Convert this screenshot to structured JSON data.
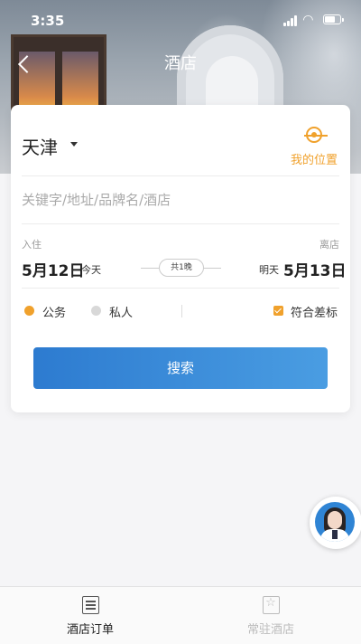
{
  "status_bar": {
    "time": "3:35"
  },
  "nav": {
    "title": "酒店"
  },
  "search_card": {
    "city": "天津",
    "my_location_label": "我的位置",
    "keyword_placeholder": "关键字/地址/品牌名/酒店",
    "checkin_label": "入住",
    "checkout_label": "离店",
    "checkin_date": "5月12日",
    "checkin_day": "今天",
    "nights": "共1晚",
    "checkout_day": "明天",
    "checkout_date": "5月13日",
    "trip_type_business": "公务",
    "trip_type_personal": "私人",
    "policy_label": "符合差标",
    "policy_checked": true,
    "search_button": "搜索"
  },
  "tabbar": {
    "tabs": [
      {
        "label": "酒店订单",
        "icon": "order-list-icon",
        "active": true
      },
      {
        "label": "常驻酒店",
        "icon": "star-icon",
        "active": false
      }
    ]
  },
  "colors": {
    "accent": "#f0a12c",
    "button_start": "#2d7bd0",
    "button_end": "#4a9de2"
  }
}
